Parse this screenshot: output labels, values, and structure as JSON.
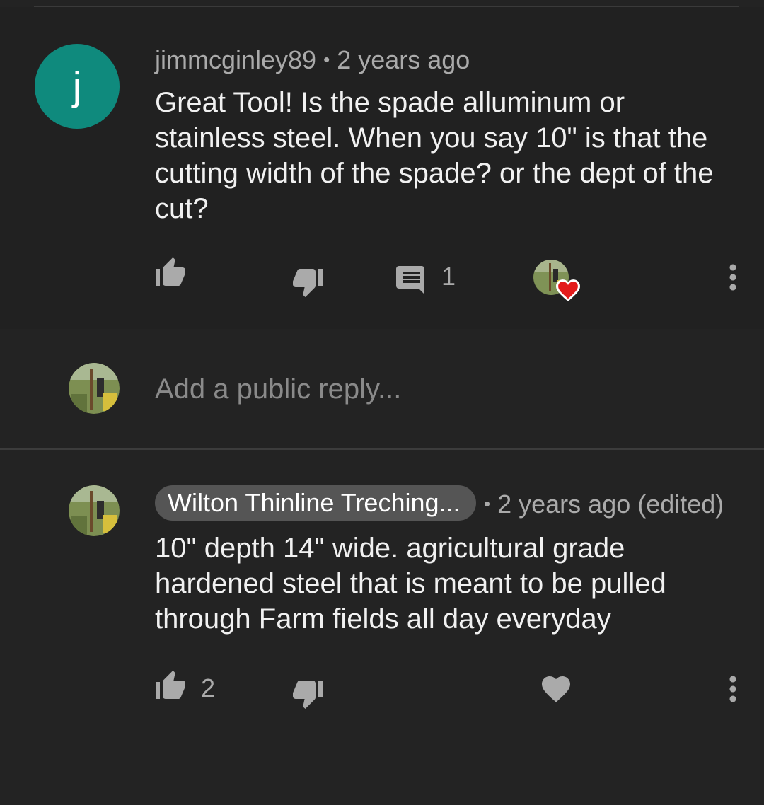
{
  "comment": {
    "avatar_letter": "j",
    "author": "jimmcginley89",
    "separator": "•",
    "time": "2 years ago",
    "text": "Great Tool!  Is the spade alluminum or stainless steel. When you say 10\" is that the cutting width of the spade? or the dept of the cut?",
    "reply_count": "1",
    "icons": [
      "thumb-up-icon",
      "thumb-down-icon",
      "comment-icon",
      "heart-icon",
      "more-vert-icon"
    ],
    "heart_color": "#e31b1b"
  },
  "reply_box": {
    "placeholder": "Add a public reply..."
  },
  "reply": {
    "author": "Wilton Thinline Treching...",
    "separator": "•",
    "time": "2 years ago (edited)",
    "text": "10\" depth 14\" wide. agricultural grade hardened steel that is meant to be pulled through Farm fields all day everyday",
    "like_count": "2",
    "icons": [
      "thumb-up-icon",
      "thumb-down-icon",
      "heart-icon",
      "more-vert-icon"
    ]
  },
  "colors": {
    "background": "#232323",
    "avatar_teal": "#0f8a7d",
    "chip_bg": "#555555",
    "secondary_text": "#aaaaaa",
    "icon": "#aaaaaa"
  }
}
